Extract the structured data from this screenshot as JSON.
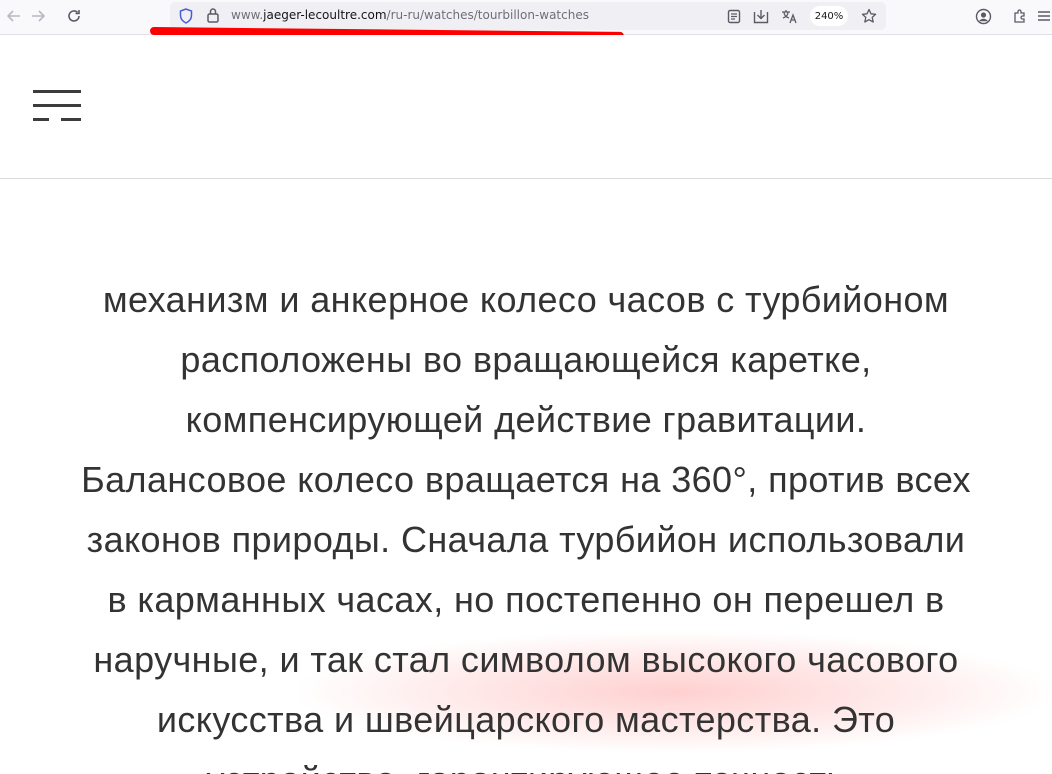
{
  "browser": {
    "url_prefix": "www.",
    "url_domain": "jaeger-lecoultre.com",
    "url_path": "/ru-ru/watches/tourbillon-watches",
    "zoom_level": "240%",
    "icons": [
      "back-icon",
      "forward-icon",
      "reload-icon",
      "shield-icon",
      "lock-icon",
      "reader-view-icon",
      "download-icon",
      "translate-icon",
      "bookmark-star-icon",
      "account-icon",
      "extensions-icon",
      "menu-icon"
    ]
  },
  "header": {
    "menu_icon": "hamburger-menu-icon"
  },
  "article": {
    "lines": [
      "механизм и анкерное колесо часов с турбийоном",
      "расположены во вращающейся каретке,",
      "компенсирующей действие гравитации.",
      "Балансовое колесо вращается на 360°, против всех",
      "законов природы. Сначала турбийон использовали",
      "в карманных часах, но постепенно он перешел в",
      "наручные, и так стал символом высокого часового",
      "искусства и швейцарского мастерства. Это",
      "устройство, гарантирующее точность"
    ]
  },
  "colors": {
    "annotation_underline": "#ff0000",
    "text": "#333333",
    "toolbar_bg": "#f9f9fb",
    "urlbar_bg": "#f0f0f4"
  }
}
